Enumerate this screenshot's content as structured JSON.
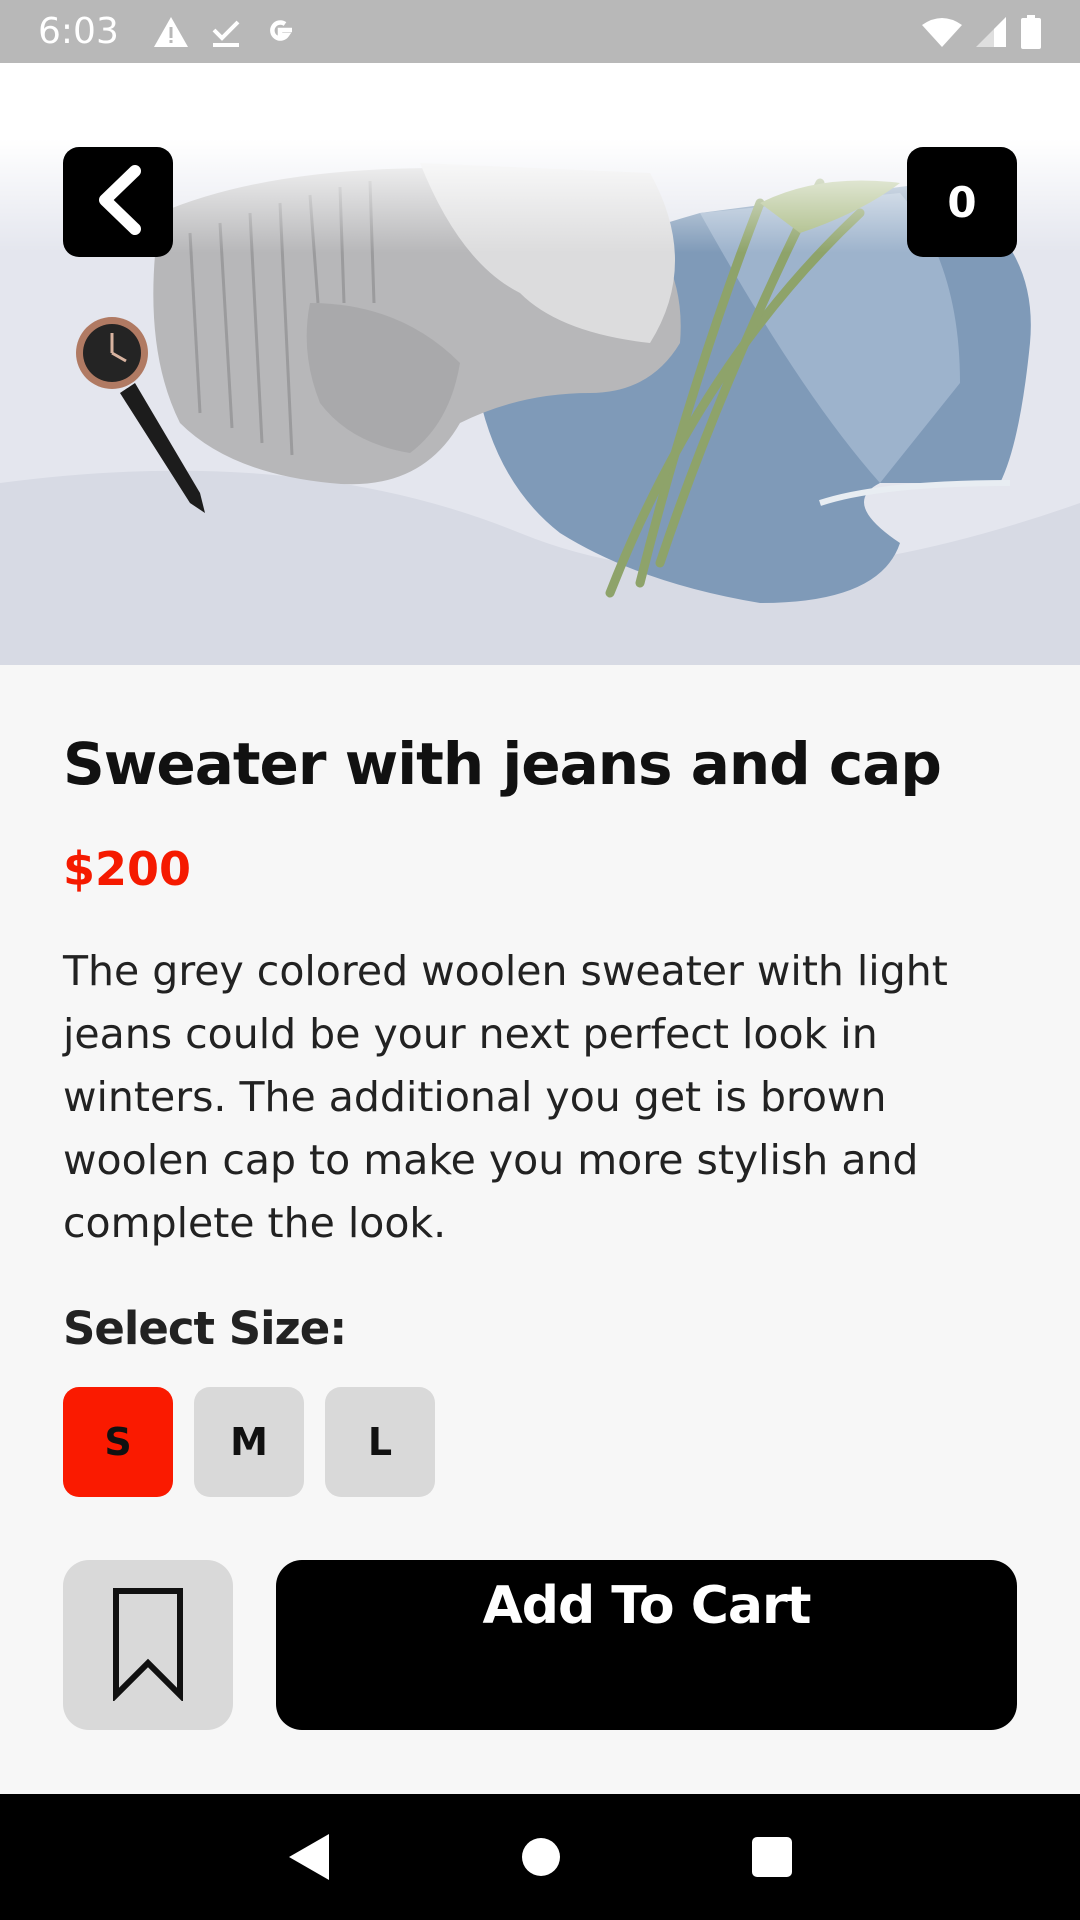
{
  "status_bar": {
    "time": "6:03",
    "left_icons": [
      "warning-icon",
      "download-done-icon",
      "google-icon"
    ],
    "right_icons": [
      "wifi-icon",
      "signal-icon",
      "battery-icon"
    ]
  },
  "header": {
    "back_icon": "chevron-left-icon",
    "cart_count": "0"
  },
  "product": {
    "title": "Sweater with jeans and cap",
    "price": "$200",
    "description": "The grey colored woolen sweater with light jeans could be your next perfect look in winters. The additional you get is brown woolen cap to make you more stylish and complete the look."
  },
  "size": {
    "heading": "Select Size:",
    "options": [
      "S",
      "M",
      "L"
    ],
    "selected": "S"
  },
  "actions": {
    "bookmark_icon": "bookmark-icon",
    "add_to_cart_label": "Add To Cart"
  },
  "colors": {
    "accent": "#fa1a00",
    "price": "#f51a00",
    "button_dark": "#000000",
    "chip": "#d9d9d9"
  },
  "nav_bar": {
    "icons": [
      "nav-back-icon",
      "nav-home-icon",
      "nav-recents-icon"
    ]
  }
}
